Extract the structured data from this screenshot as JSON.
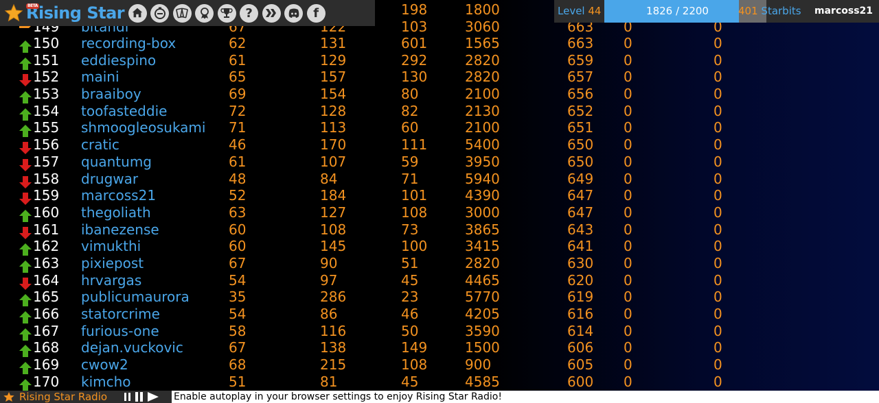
{
  "nav": {
    "logo_text": "Rising Star",
    "beta_label": "BETA",
    "buttons": [
      "home-icon",
      "timer-icon",
      "cards-icon",
      "badge-icon",
      "trophy-icon",
      "help-icon",
      "hive-icon",
      "discord-icon",
      "facebook-icon"
    ],
    "help_glyph": "?",
    "facebook_glyph": "f"
  },
  "status": {
    "level_label": "Level",
    "level": "44",
    "xp_text": "1826 / 2200",
    "xp_fraction": 0.83,
    "starbits_count": "401",
    "starbits_label": "Starbits",
    "username": "marcoss21"
  },
  "colors": {
    "accent_blue": "#4aa6e9",
    "accent_orange": "#f39220",
    "arrow_up": "#4caf1e",
    "arrow_down": "#d91c1c",
    "bar_bg": "#2d2d2d"
  },
  "partial_top_row": {
    "cols": [
      "198",
      "1800"
    ]
  },
  "partial_row_149": {
    "rank": "149",
    "user": "bitandi",
    "cols": [
      "67",
      "122",
      "103",
      "3060",
      "663",
      "0",
      "0"
    ],
    "trend": "flat"
  },
  "rows": [
    {
      "trend": "up",
      "rank": "150",
      "user": "recording-box",
      "cols": [
        "62",
        "131",
        "601",
        "1565",
        "663",
        "0",
        "0"
      ]
    },
    {
      "trend": "up",
      "rank": "151",
      "user": "eddiespino",
      "cols": [
        "61",
        "129",
        "292",
        "2820",
        "659",
        "0",
        "0"
      ]
    },
    {
      "trend": "down",
      "rank": "152",
      "user": "maini",
      "cols": [
        "65",
        "157",
        "130",
        "2820",
        "657",
        "0",
        "0"
      ]
    },
    {
      "trend": "up",
      "rank": "153",
      "user": "braaiboy",
      "cols": [
        "69",
        "154",
        "80",
        "2100",
        "656",
        "0",
        "0"
      ]
    },
    {
      "trend": "up",
      "rank": "154",
      "user": "toofasteddie",
      "cols": [
        "72",
        "128",
        "82",
        "2130",
        "652",
        "0",
        "0"
      ]
    },
    {
      "trend": "up",
      "rank": "155",
      "user": "shmoogleosukami",
      "cols": [
        "71",
        "113",
        "60",
        "2100",
        "651",
        "0",
        "0"
      ]
    },
    {
      "trend": "down",
      "rank": "156",
      "user": "cratic",
      "cols": [
        "46",
        "170",
        "111",
        "5400",
        "650",
        "0",
        "0"
      ]
    },
    {
      "trend": "down",
      "rank": "157",
      "user": "quantumg",
      "cols": [
        "61",
        "107",
        "59",
        "3950",
        "650",
        "0",
        "0"
      ]
    },
    {
      "trend": "down",
      "rank": "158",
      "user": "drugwar",
      "cols": [
        "48",
        "84",
        "71",
        "5940",
        "649",
        "0",
        "0"
      ]
    },
    {
      "trend": "down",
      "rank": "159",
      "user": "marcoss21",
      "cols": [
        "52",
        "184",
        "101",
        "4390",
        "647",
        "0",
        "0"
      ]
    },
    {
      "trend": "up",
      "rank": "160",
      "user": "thegoliath",
      "cols": [
        "63",
        "127",
        "108",
        "3000",
        "647",
        "0",
        "0"
      ]
    },
    {
      "trend": "down",
      "rank": "161",
      "user": "ibanezense",
      "cols": [
        "60",
        "108",
        "73",
        "3865",
        "643",
        "0",
        "0"
      ]
    },
    {
      "trend": "up",
      "rank": "162",
      "user": "vimukthi",
      "cols": [
        "60",
        "145",
        "100",
        "3415",
        "641",
        "0",
        "0"
      ]
    },
    {
      "trend": "up",
      "rank": "163",
      "user": "pixiepost",
      "cols": [
        "67",
        "90",
        "51",
        "2820",
        "630",
        "0",
        "0"
      ]
    },
    {
      "trend": "down",
      "rank": "164",
      "user": "hrvargas",
      "cols": [
        "54",
        "97",
        "45",
        "4465",
        "620",
        "0",
        "0"
      ]
    },
    {
      "trend": "up",
      "rank": "165",
      "user": "publicumaurora",
      "cols": [
        "35",
        "286",
        "23",
        "5770",
        "619",
        "0",
        "0"
      ]
    },
    {
      "trend": "up",
      "rank": "166",
      "user": "statorcrime",
      "cols": [
        "54",
        "86",
        "46",
        "4205",
        "616",
        "0",
        "0"
      ]
    },
    {
      "trend": "up",
      "rank": "167",
      "user": "furious-one",
      "cols": [
        "58",
        "116",
        "50",
        "3590",
        "614",
        "0",
        "0"
      ]
    },
    {
      "trend": "up",
      "rank": "168",
      "user": "dejan.vuckovic",
      "cols": [
        "67",
        "138",
        "149",
        "1500",
        "606",
        "0",
        "0"
      ]
    },
    {
      "trend": "up",
      "rank": "169",
      "user": "cwow2",
      "cols": [
        "68",
        "215",
        "108",
        "900",
        "605",
        "0",
        "0"
      ]
    },
    {
      "trend": "up",
      "rank": "170",
      "user": "kimcho",
      "cols": [
        "51",
        "81",
        "45",
        "4585",
        "600",
        "0",
        "0"
      ]
    }
  ],
  "radio": {
    "title": "Rising Star Radio",
    "message": "Enable autoplay in your browser settings to enjoy Rising Star Radio!"
  }
}
